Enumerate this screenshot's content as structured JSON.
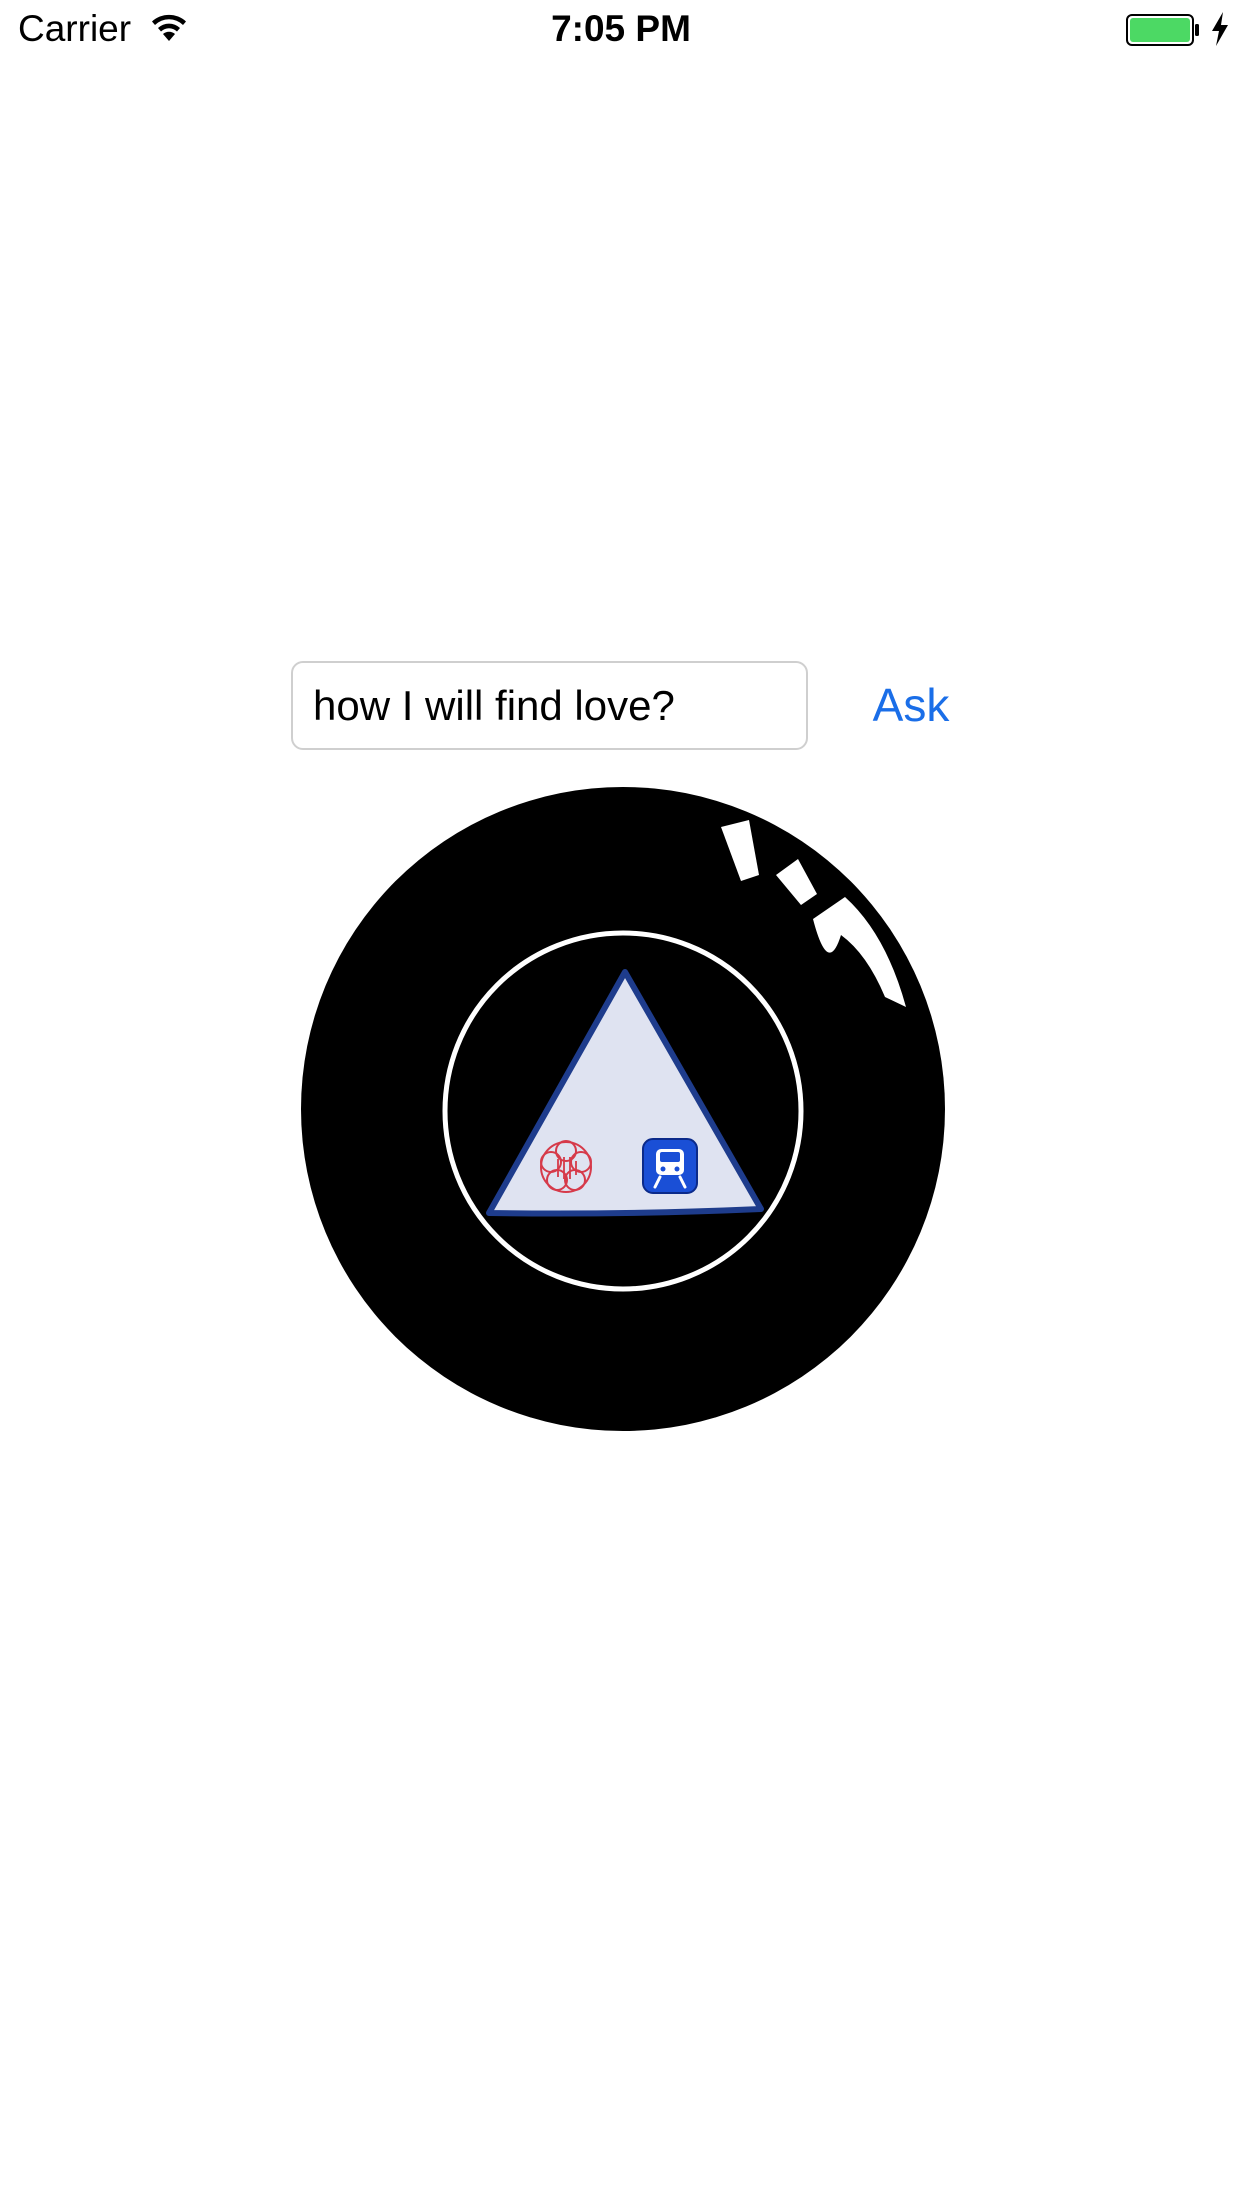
{
  "status_bar": {
    "carrier": "Carrier",
    "time": "7:05 PM",
    "battery_color": "#4cd964"
  },
  "question": {
    "value": "how I will find love?",
    "placeholder": ""
  },
  "ask_button": {
    "label": "Ask",
    "color": "#1a6ee8"
  },
  "eight_ball": {
    "ball_color": "#000000",
    "window_ring_color": "#ffffff",
    "triangle_fill": "#dfe3f1",
    "triangle_border": "#1e3c8c",
    "icons": [
      "stamp-icon",
      "train-icon"
    ]
  }
}
